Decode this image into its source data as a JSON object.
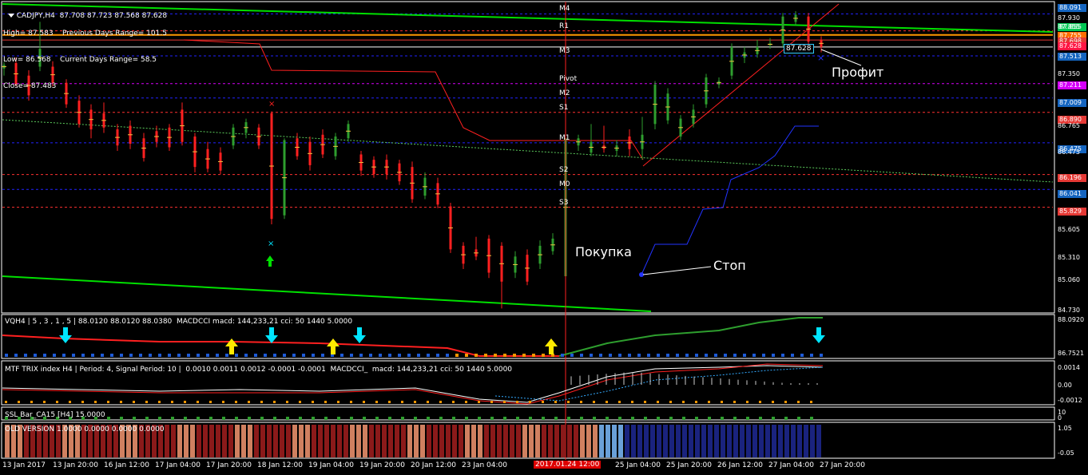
{
  "header": {
    "symbol_line": "CADJPY,H4  87.708 87.723 87.568 87.628",
    "high_line": "High= 87.583    Previous Days Range= 101.5",
    "low_line": "Low= 86.568    Current Days Range= 58.5",
    "close_line": "Close= 87.483"
  },
  "pivots": [
    {
      "name": "M4",
      "price": 87.99
    },
    {
      "name": "R1",
      "price": 87.8
    },
    {
      "name": "M3",
      "price": 87.52
    },
    {
      "name": "Pivot",
      "price": 87.211
    },
    {
      "name": "M2",
      "price": 87.05
    },
    {
      "name": "S1",
      "price": 86.89
    },
    {
      "name": "M1",
      "price": 86.55
    },
    {
      "name": "S2",
      "price": 86.196
    },
    {
      "name": "M0",
      "price": 86.03
    },
    {
      "name": "S3",
      "price": 85.83
    }
  ],
  "price_axis": {
    "ticks": [
      "87.930",
      "87.855",
      "87.350",
      "86.765",
      "86.475",
      "85.605",
      "85.310",
      "85.060",
      "84.730"
    ]
  },
  "price_labels": [
    {
      "text": "88.091",
      "color": "#1565c0"
    },
    {
      "text": "87.855",
      "color": "#00c853"
    },
    {
      "text": "87.755",
      "color": "#ff6d00"
    },
    {
      "text": "87.698",
      "color": "#e53935"
    },
    {
      "text": "87.628",
      "color": "#ff1744"
    },
    {
      "text": "87.513",
      "color": "#1565c0"
    },
    {
      "text": "87.211",
      "color": "#d500f9"
    },
    {
      "text": "87.009",
      "color": "#1565c0"
    },
    {
      "text": "86.890",
      "color": "#e53935"
    },
    {
      "text": "86.475",
      "color": "#1565c0"
    },
    {
      "text": "86.196",
      "color": "#e53935"
    },
    {
      "text": "86.041",
      "color": "#1565c0"
    },
    {
      "text": "85.829",
      "color": "#e53935"
    }
  ],
  "current_price": "87.628",
  "annotations": {
    "buy": "Покупка",
    "stop": "Стоп",
    "profit": "Профит"
  },
  "indicators": {
    "vqh": {
      "label": "VQH4 | 5 , 3 , 1 , 5 | 88.0120 88.0120 88.0380  MACDCCI macd: 144,233,21 cci: 50 1440 5.0000",
      "axis_top": "88.0920",
      "axis_bottom": "86.7521"
    },
    "trix": {
      "label": "MTF TRIX index H4 | Period: 4, Signal Period: 10 |  0.0010 0.0011 0.0012 -0.0001 -0.0001  MACDCCI_  macd: 144,233,21 cci: 50 1440 5.0000",
      "axis_top": "0.0014",
      "axis_mid": "0.00",
      "axis_bottom": "-0.0012"
    },
    "ssl": {
      "label": "SSL Bar_CA15 [H4] 15.0000",
      "axis_top": "10",
      "axis_bottom": "0"
    },
    "old": {
      "label": "OLD VERSION 1.0000 0.0000 0.0000 0.0000",
      "axis_top": "1.05",
      "axis_bottom": "-0.05"
    }
  },
  "time_axis": {
    "labels": [
      "13 Jan 2017",
      "13 Jan 20:00",
      "16 Jan 12:00",
      "17 Jan 04:00",
      "17 Jan 20:00",
      "18 Jan 12:00",
      "19 Jan 04:00",
      "19 Jan 20:00",
      "20 Jan 12:00",
      "23 Jan 04:00",
      "25 Jan 04:00",
      "25 Jan 20:00",
      "26 Jan 12:00",
      "27 Jan 04:00",
      "27 Jan 20:00"
    ],
    "crosshair_label": "2017.01.24 12:00"
  },
  "colors": {
    "bull": "#2e9e2e",
    "bear": "#ff2020",
    "trendline": "#00e000"
  }
}
